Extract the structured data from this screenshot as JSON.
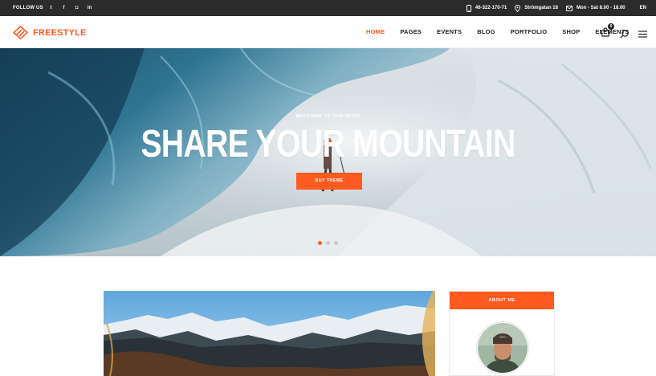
{
  "topbar": {
    "follow_label": "FOLLOW US",
    "social": [
      {
        "icon": "twitter-icon",
        "glyph": "t"
      },
      {
        "icon": "facebook-icon",
        "glyph": "f"
      },
      {
        "icon": "instagram-icon",
        "glyph": "◘"
      },
      {
        "icon": "linkedin-icon",
        "glyph": "in"
      }
    ],
    "phone": "46-322-170-71",
    "address": "Strömgatan 18",
    "hours": "Mon - Sat 8.00 - 18.00",
    "language": "EN"
  },
  "header": {
    "logo_text": "FREESTYLE",
    "nav": [
      "HOME",
      "PAGES",
      "EVENTS",
      "BLOG",
      "PORTFOLIO",
      "SHOP",
      "ELEMENTS"
    ],
    "active_nav": "HOME",
    "cart_count": "0"
  },
  "hero": {
    "subtitle": "WELCOME TO OUR BLOG",
    "title": "SHARE YOUR MOUNTAIN",
    "button_label": "BUY THEME",
    "slides": 3,
    "active_slide": 1
  },
  "sidebar": {
    "about_title": "ABOUT ME"
  },
  "colors": {
    "accent": "#ff5a1f",
    "topbar_bg": "#2b2b2b",
    "text_dark": "#222222"
  }
}
